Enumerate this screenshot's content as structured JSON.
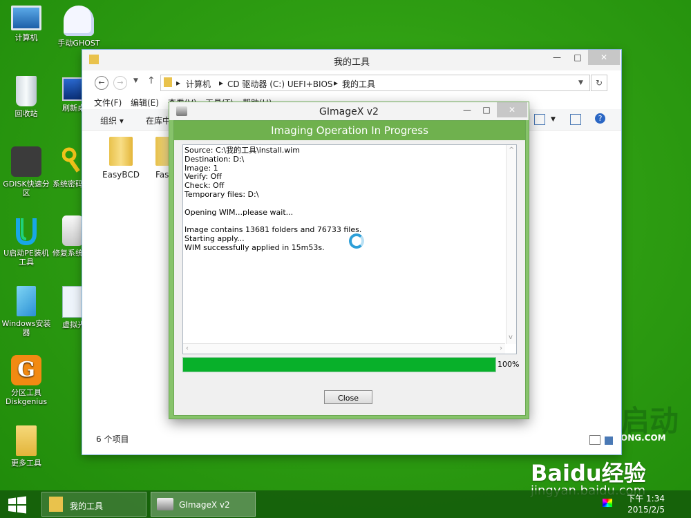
{
  "desktop": {
    "icons": [
      {
        "label": "计算机"
      },
      {
        "label": "手动GHOST"
      },
      {
        "label": "回收站"
      },
      {
        "label": "刷新桌"
      },
      {
        "label": "GDISK快速分区"
      },
      {
        "label": "系统密码"
      },
      {
        "label": "U启动PE装机工具"
      },
      {
        "label": "修复系统"
      },
      {
        "label": "Windows安装器"
      },
      {
        "label": "虚拟光"
      },
      {
        "label": "分区工具Diskgenius"
      },
      {
        "label": "更多工具"
      }
    ],
    "watermark_logo": "启动",
    "watermark_small": "ONG.COM",
    "baidu_text": "Baidu经验",
    "baidu_url": "jingyan.baidu.com"
  },
  "explorer": {
    "title": "我的工具",
    "address": {
      "parts": [
        "计算机",
        "CD 驱动器 (C:) UEFI+BIOS",
        "我的工具"
      ]
    },
    "menu": [
      "文件(F)",
      "编辑(E)",
      "查看(V)",
      "工具(T)",
      "帮助(H)"
    ],
    "toolbar": {
      "organize": "组织 ▾",
      "include": "在库中"
    },
    "items": [
      {
        "label": "EasyBCD"
      },
      {
        "label": "Fast"
      }
    ],
    "status": "6 个项目"
  },
  "gimagex": {
    "title": "GImageX v2",
    "banner": "Imaging Operation In Progress",
    "log": "Source: C:\\我的工具\\install.wim\nDestination: D:\\\nImage: 1\nVerify: Off\nCheck: Off\nTemporary files: D:\\\n\nOpening WIM...please wait...\n\nImage contains 13681 folders and 76733 files.\nStarting apply...\nWIM successfully applied in 15m53s.",
    "progress": 1.0,
    "progress_label": "100%",
    "close_label": "Close"
  },
  "taskbar": {
    "items": [
      {
        "label": "我的工具"
      },
      {
        "label": "GImageX v2"
      }
    ],
    "time": "下午 1:34",
    "date": "2015/2/5"
  },
  "colors": {
    "desktop": "#2e9d12",
    "dialog_frame": "#87c36b",
    "progress": "#08b02a"
  }
}
